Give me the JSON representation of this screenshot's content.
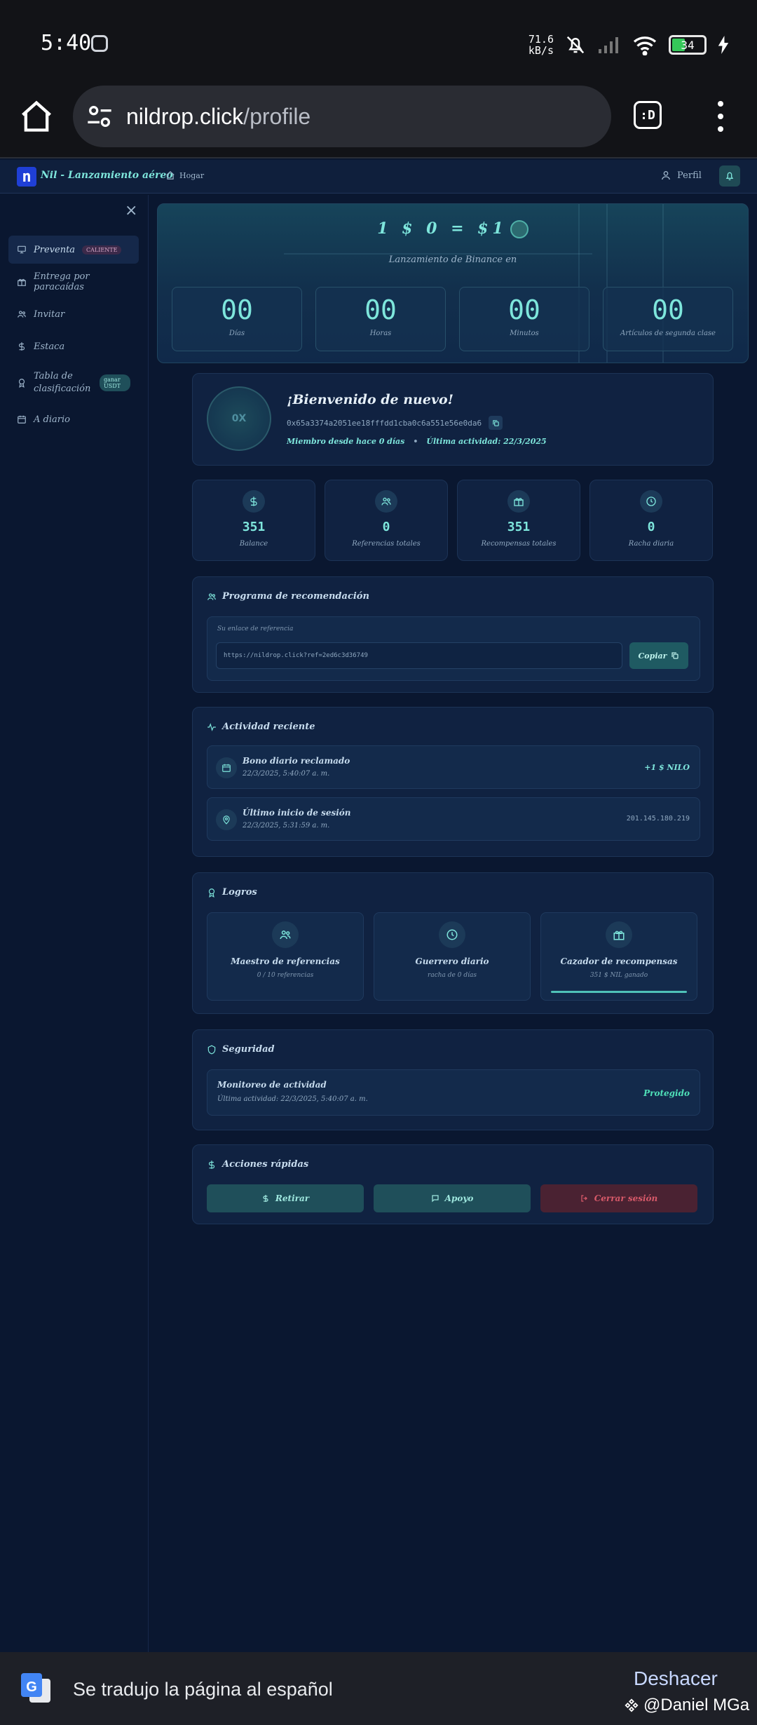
{
  "status_bar": {
    "time": "5:40",
    "net_speed_value": "71.6",
    "net_speed_unit": "kB/s",
    "battery": "34"
  },
  "browser": {
    "url_domain": "nildrop.click",
    "url_path": "/profile",
    "tab_label": ":D"
  },
  "header": {
    "logo_letter": "n",
    "brand": "Nil - Lanzamiento aéreo",
    "breadcrumb": "Hogar",
    "profile_label": "Perfil"
  },
  "sidebar": {
    "close_glyph": "×",
    "items": [
      {
        "label": "Preventa",
        "badge": "CALIENTE",
        "icon": "monitor-icon"
      },
      {
        "label": "Entrega por paracaídas",
        "icon": "gift-icon"
      },
      {
        "label": "Invitar",
        "icon": "users-icon"
      },
      {
        "label": "Estaca",
        "icon": "dollar-icon"
      },
      {
        "label": "Tabla de clasificación",
        "badge": "ganar USDT",
        "icon": "award-icon"
      },
      {
        "label": "A diario",
        "icon": "calendar-icon"
      }
    ]
  },
  "hero": {
    "rate_text": "1 $ 0 = $1",
    "subtitle": "Lanzamiento de Binance en",
    "countdown": [
      {
        "value": "00",
        "label": "Días"
      },
      {
        "value": "00",
        "label": "Horas"
      },
      {
        "value": "00",
        "label": "Minutos"
      },
      {
        "value": "00",
        "label": "Artículos de segunda clase"
      }
    ]
  },
  "welcome": {
    "avatar_text": "0X",
    "title": "¡Bienvenido de nuevo!",
    "address": "0x65a3374a2051ee18fffdd1cba0c6a551e56e0da6",
    "member_since": "Miembro desde hace 0 días",
    "last_activity": "Última actividad: 22/3/2025"
  },
  "stats": [
    {
      "value": "351",
      "label": "Balance",
      "icon": "dollar-icon"
    },
    {
      "value": "0",
      "label": "Referencias totales",
      "icon": "users-icon"
    },
    {
      "value": "351",
      "label": "Recompensas totales",
      "icon": "gift-icon"
    },
    {
      "value": "0",
      "label": "Racha diaria",
      "icon": "clock-icon"
    }
  ],
  "referral": {
    "title": "Programa de recomendación",
    "link_label": "Su enlace de referencia",
    "link_value": "https://nildrop.click?ref=2ed6c3d36749",
    "copy_label": "Copiar"
  },
  "activity": {
    "title": "Actividad reciente",
    "rows": [
      {
        "title": "Bono diario reclamado",
        "time": "22/3/2025, 5:40:07 a. m.",
        "right": "+1 $ NILO",
        "icon": "calendar-icon"
      },
      {
        "title": "Último inicio de sesión",
        "time": "22/3/2025, 5:31:59 a. m.",
        "right": "201.145.180.219",
        "icon": "location-icon"
      }
    ]
  },
  "achievements": {
    "title": "Logros",
    "items": [
      {
        "title": "Maestro de referencias",
        "sub": "0 / 10 referencias",
        "icon": "users-icon"
      },
      {
        "title": "Guerrero diario",
        "sub": "racha de 0 días",
        "icon": "clock-icon"
      },
      {
        "title": "Cazador de recompensas",
        "sub": "351 $ NIL ganado",
        "icon": "gift-icon",
        "progress": 1.0
      }
    ]
  },
  "security": {
    "title": "Seguridad",
    "row_title": "Monitoreo de actividad",
    "row_sub": "Última actividad: 22/3/2025, 5:40:07 a. m.",
    "status": "Protegido"
  },
  "quick_actions": {
    "title": "Acciones rápidas",
    "withdraw": "Retirar",
    "support": "Apoyo",
    "logout": "Cerrar sesión"
  },
  "translate": {
    "message": "Se tradujo la página al español",
    "undo": "Deshacer",
    "watermark": "@Daniel MGa"
  },
  "colors": {
    "accent": "#7ee6dc",
    "background": "#0a1730",
    "card": "#102241",
    "danger": "#d85a6a"
  }
}
